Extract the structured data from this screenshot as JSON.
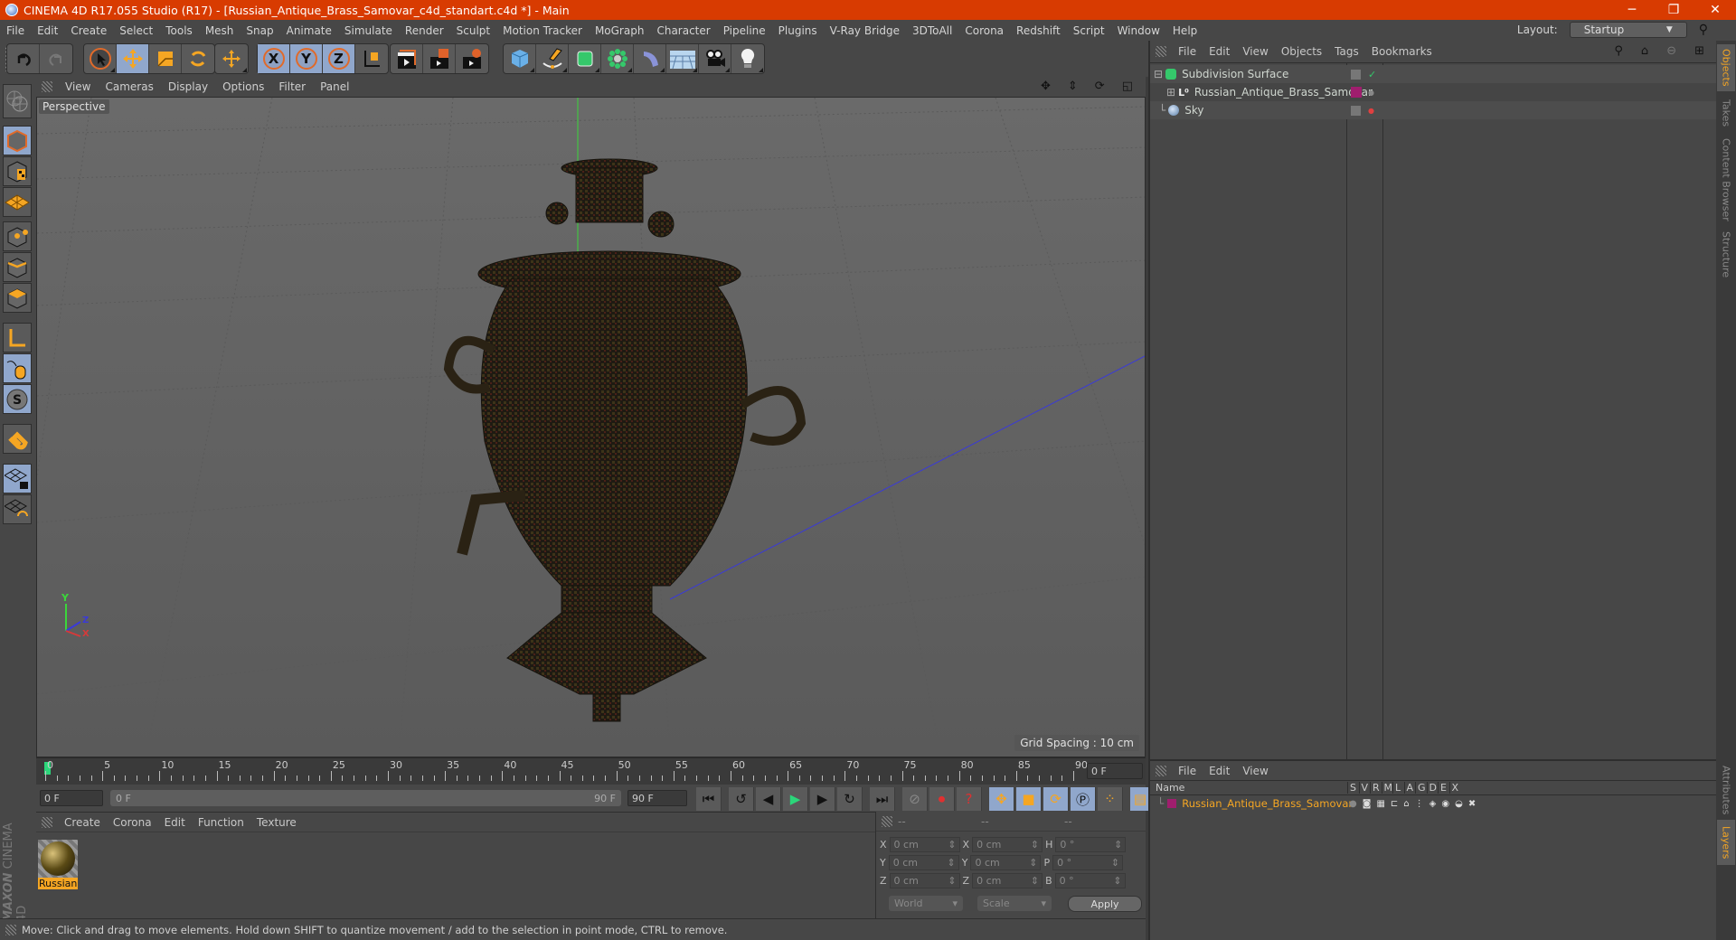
{
  "window": {
    "title": "CINEMA 4D R17.055 Studio (R17) - [Russian_Antique_Brass_Samovar_c4d_standart.c4d *] - Main",
    "controls": {
      "minimize": "─",
      "restore": "❐",
      "close": "✕"
    }
  },
  "menubar": {
    "items": [
      "File",
      "Edit",
      "Create",
      "Select",
      "Tools",
      "Mesh",
      "Snap",
      "Animate",
      "Simulate",
      "Render",
      "Sculpt",
      "Motion Tracker",
      "MoGraph",
      "Character",
      "Pipeline",
      "Plugins",
      "V-Ray Bridge",
      "3DToAll",
      "Corona",
      "Redshift",
      "Script",
      "Window",
      "Help"
    ],
    "layout_label": "Layout:",
    "layout_value": "Startup"
  },
  "toolbar": {
    "groups": [
      [
        "undo-icon",
        "redo-icon"
      ],
      [
        "live-selection-icon",
        "move-icon",
        "scale-icon",
        "rotate-icon"
      ],
      [
        "recent-tools-icon"
      ],
      [
        "x-axis-icon",
        "y-axis-icon",
        "z-axis-icon",
        "coordinate-system-icon"
      ],
      [
        "render-view-icon",
        "render-picture-viewer-icon",
        "render-settings-icon"
      ],
      [
        "cube-icon",
        "pen-spline-icon",
        "subdivision-surface-icon",
        "cloner-icon",
        "bend-deformer-icon",
        "floor-icon",
        "camera-icon",
        "light-icon"
      ]
    ],
    "axis_labels": [
      "X",
      "Y",
      "Z"
    ]
  },
  "left_tools": [
    "make-editable-icon",
    "model-mode-icon",
    "texture-mode-icon",
    "workplane-mode-icon",
    "points-mode-icon",
    "edges-mode-icon",
    "polygons-mode-icon",
    "axis-mode-icon",
    "tweak-mode-icon",
    "solo-icon",
    "snap-magnet-icon",
    "locked-workplane-icon",
    "workplane-rotate-icon"
  ],
  "viewport": {
    "menu": [
      "View",
      "Cameras",
      "Display",
      "Options",
      "Filter",
      "Panel"
    ],
    "camera_label": "Perspective",
    "grid_spacing": "Grid Spacing : 10 cm",
    "axis_labels": {
      "x": "X",
      "y": "Y",
      "z": "Z"
    }
  },
  "timeline": {
    "ticks": [
      "0",
      "5",
      "10",
      "15",
      "20",
      "25",
      "30",
      "35",
      "40",
      "45",
      "50",
      "55",
      "60",
      "65",
      "70",
      "75",
      "80",
      "85",
      "90"
    ],
    "current_frame": "0 F",
    "start_field": "0 F",
    "range_start": "0 F",
    "range_end": "90 F",
    "end_field": "90 F"
  },
  "materials": {
    "menu": [
      "Create",
      "Corona",
      "Edit",
      "Function",
      "Texture"
    ],
    "items": [
      {
        "name": "Russian"
      }
    ]
  },
  "coordinates": {
    "headers": [
      "--",
      "--",
      "--"
    ],
    "rows": [
      {
        "a": "X",
        "av": "0 cm",
        "b": "X",
        "bv": "0 cm",
        "c": "H",
        "cv": "0 °"
      },
      {
        "a": "Y",
        "av": "0 cm",
        "b": "Y",
        "bv": "0 cm",
        "c": "P",
        "cv": "0 °"
      },
      {
        "a": "Z",
        "av": "0 cm",
        "b": "Z",
        "bv": "0 cm",
        "c": "B",
        "cv": "0 °"
      }
    ],
    "mode": "World",
    "type": "Scale",
    "apply": "Apply"
  },
  "status": {
    "text": "Move: Click and drag to move elements. Hold down SHIFT to quantize movement / add to the selection in point mode, CTRL to remove."
  },
  "objects": {
    "menu": [
      "File",
      "Edit",
      "View",
      "Objects",
      "Tags",
      "Bookmarks"
    ],
    "items": [
      {
        "name": "Subdivision Surface",
        "icon": "subdivision-surface-icon",
        "color": "#cfd6cf"
      },
      {
        "name": "Russian_Antique_Brass_Samovar",
        "icon": "null-object-icon",
        "color": "#cfd6cf",
        "layer_color": "#a01e6e"
      },
      {
        "name": "Sky",
        "icon": "sky-icon",
        "color": "#cfd6cf"
      }
    ]
  },
  "layers": {
    "menu": [
      "File",
      "Edit",
      "View"
    ],
    "columns": [
      "Name",
      "S",
      "V",
      "R",
      "M",
      "L",
      "A",
      "G",
      "D",
      "E",
      "X"
    ],
    "items": [
      {
        "name": "Russian_Antique_Brass_Samovar",
        "color": "#a01e6e"
      }
    ]
  },
  "right_tabs": {
    "top": [
      "Objects",
      "Takes",
      "Content Browser",
      "Structure"
    ],
    "bottom": [
      "Attributes",
      "Layers"
    ]
  },
  "branding": {
    "maxon": "MAXON",
    "product": "CINEMA 4D"
  }
}
